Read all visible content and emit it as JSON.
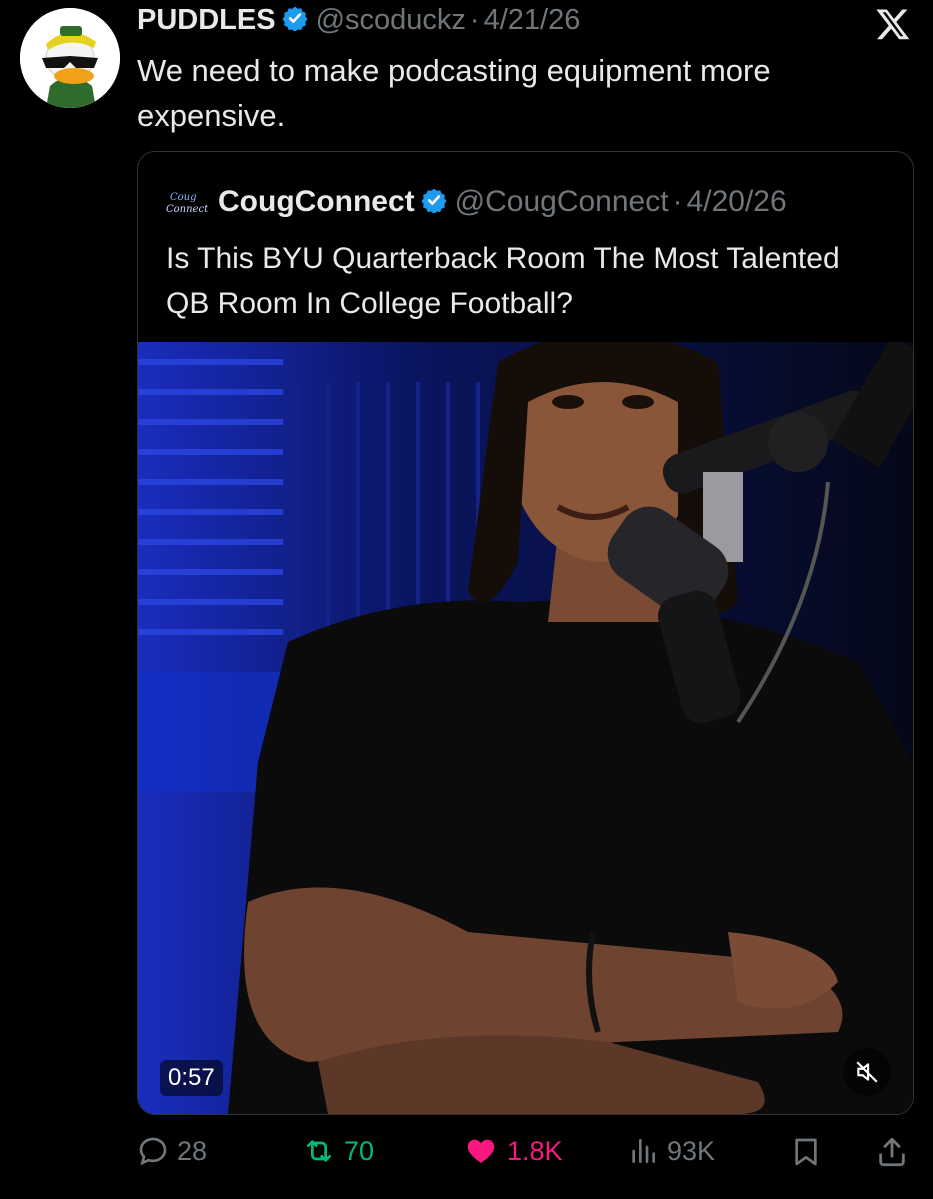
{
  "post": {
    "author_name": "PUDDLES",
    "handle": "@scoduckz",
    "separator": "·",
    "date": "4/21/26",
    "text": "We need to make podcasting equipment more expensive."
  },
  "quoted": {
    "author_name": "CougConnect",
    "handle": "@CougConnect",
    "separator": "·",
    "date": "4/20/26",
    "text": "Is This BYU Quarterback Room The Most Talented QB Room In College Football?",
    "logo_text": "Coug Connect",
    "video_duration": "0:57"
  },
  "actions": {
    "replies": "28",
    "reposts": "70",
    "likes": "1.8K",
    "views": "93K"
  },
  "colors": {
    "background": "#000000",
    "text": "#e7e9ea",
    "muted": "#71767b",
    "verified": "#1d9bf0",
    "repost": "#00ba7c",
    "like": "#f91880"
  },
  "icons": [
    "verified-badge-icon",
    "x-logo-icon",
    "mute-icon",
    "reply-icon",
    "repost-icon",
    "heart-icon",
    "views-icon",
    "bookmark-icon",
    "share-icon"
  ]
}
